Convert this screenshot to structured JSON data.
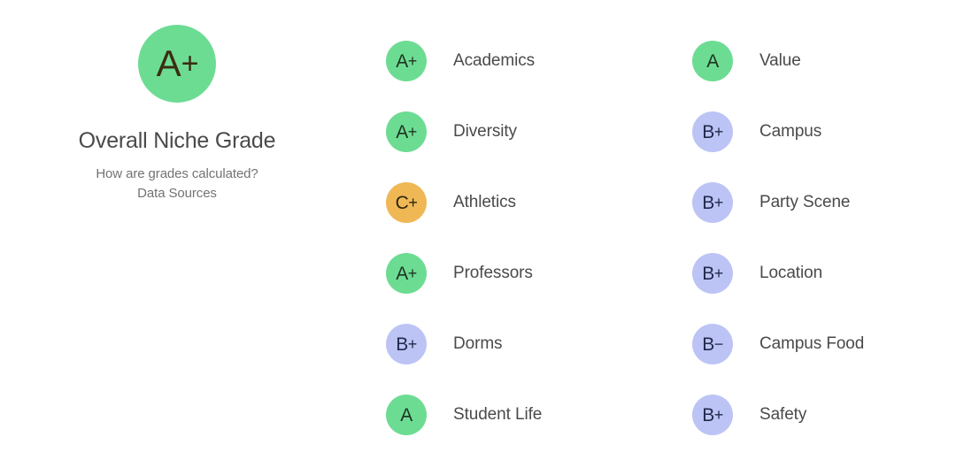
{
  "overall": {
    "badge_letter": "A",
    "badge_modifier": "+",
    "badge_grade": "A+",
    "badge_color": "#6ddc93",
    "badge_text_color": "#3a2d12",
    "title": "Overall Niche Grade",
    "links": [
      {
        "label": "How are grades calculated?",
        "name": "how-are-grades-calculated-link"
      },
      {
        "label": "Data Sources",
        "name": "data-sources-link"
      }
    ]
  },
  "colors": {
    "green": "#6ddc93",
    "green_text": "#1d3321",
    "orange": "#f0b855",
    "orange_text": "#2e2410",
    "lavender": "#bcc4f5",
    "lavender_text": "#22294d",
    "label_text": "#4a4a4a",
    "title_text": "#4a4a4a",
    "link_text": "#737373",
    "background": "#ffffff"
  },
  "columns": [
    {
      "name": "grades-column-left",
      "rows": [
        {
          "grade": "A+",
          "letter": "A",
          "modifier": "+",
          "label": "Academics",
          "color": "green"
        },
        {
          "grade": "A+",
          "letter": "A",
          "modifier": "+",
          "label": "Diversity",
          "color": "green"
        },
        {
          "grade": "C+",
          "letter": "C",
          "modifier": "+",
          "label": "Athletics",
          "color": "orange"
        },
        {
          "grade": "A+",
          "letter": "A",
          "modifier": "+",
          "label": "Professors",
          "color": "green"
        },
        {
          "grade": "B+",
          "letter": "B",
          "modifier": "+",
          "label": "Dorms",
          "color": "lavender"
        },
        {
          "grade": "A",
          "letter": "A",
          "modifier": "",
          "label": "Student Life",
          "color": "green"
        }
      ]
    },
    {
      "name": "grades-column-right",
      "rows": [
        {
          "grade": "A",
          "letter": "A",
          "modifier": "",
          "label": "Value",
          "color": "green"
        },
        {
          "grade": "B+",
          "letter": "B",
          "modifier": "+",
          "label": "Campus",
          "color": "lavender"
        },
        {
          "grade": "B+",
          "letter": "B",
          "modifier": "+",
          "label": "Party Scene",
          "color": "lavender"
        },
        {
          "grade": "B+",
          "letter": "B",
          "modifier": "+",
          "label": "Location",
          "color": "lavender"
        },
        {
          "grade": "B−",
          "letter": "B",
          "modifier": "−",
          "label": "Campus Food",
          "color": "lavender"
        },
        {
          "grade": "B+",
          "letter": "B",
          "modifier": "+",
          "label": "Safety",
          "color": "lavender"
        }
      ]
    }
  ]
}
